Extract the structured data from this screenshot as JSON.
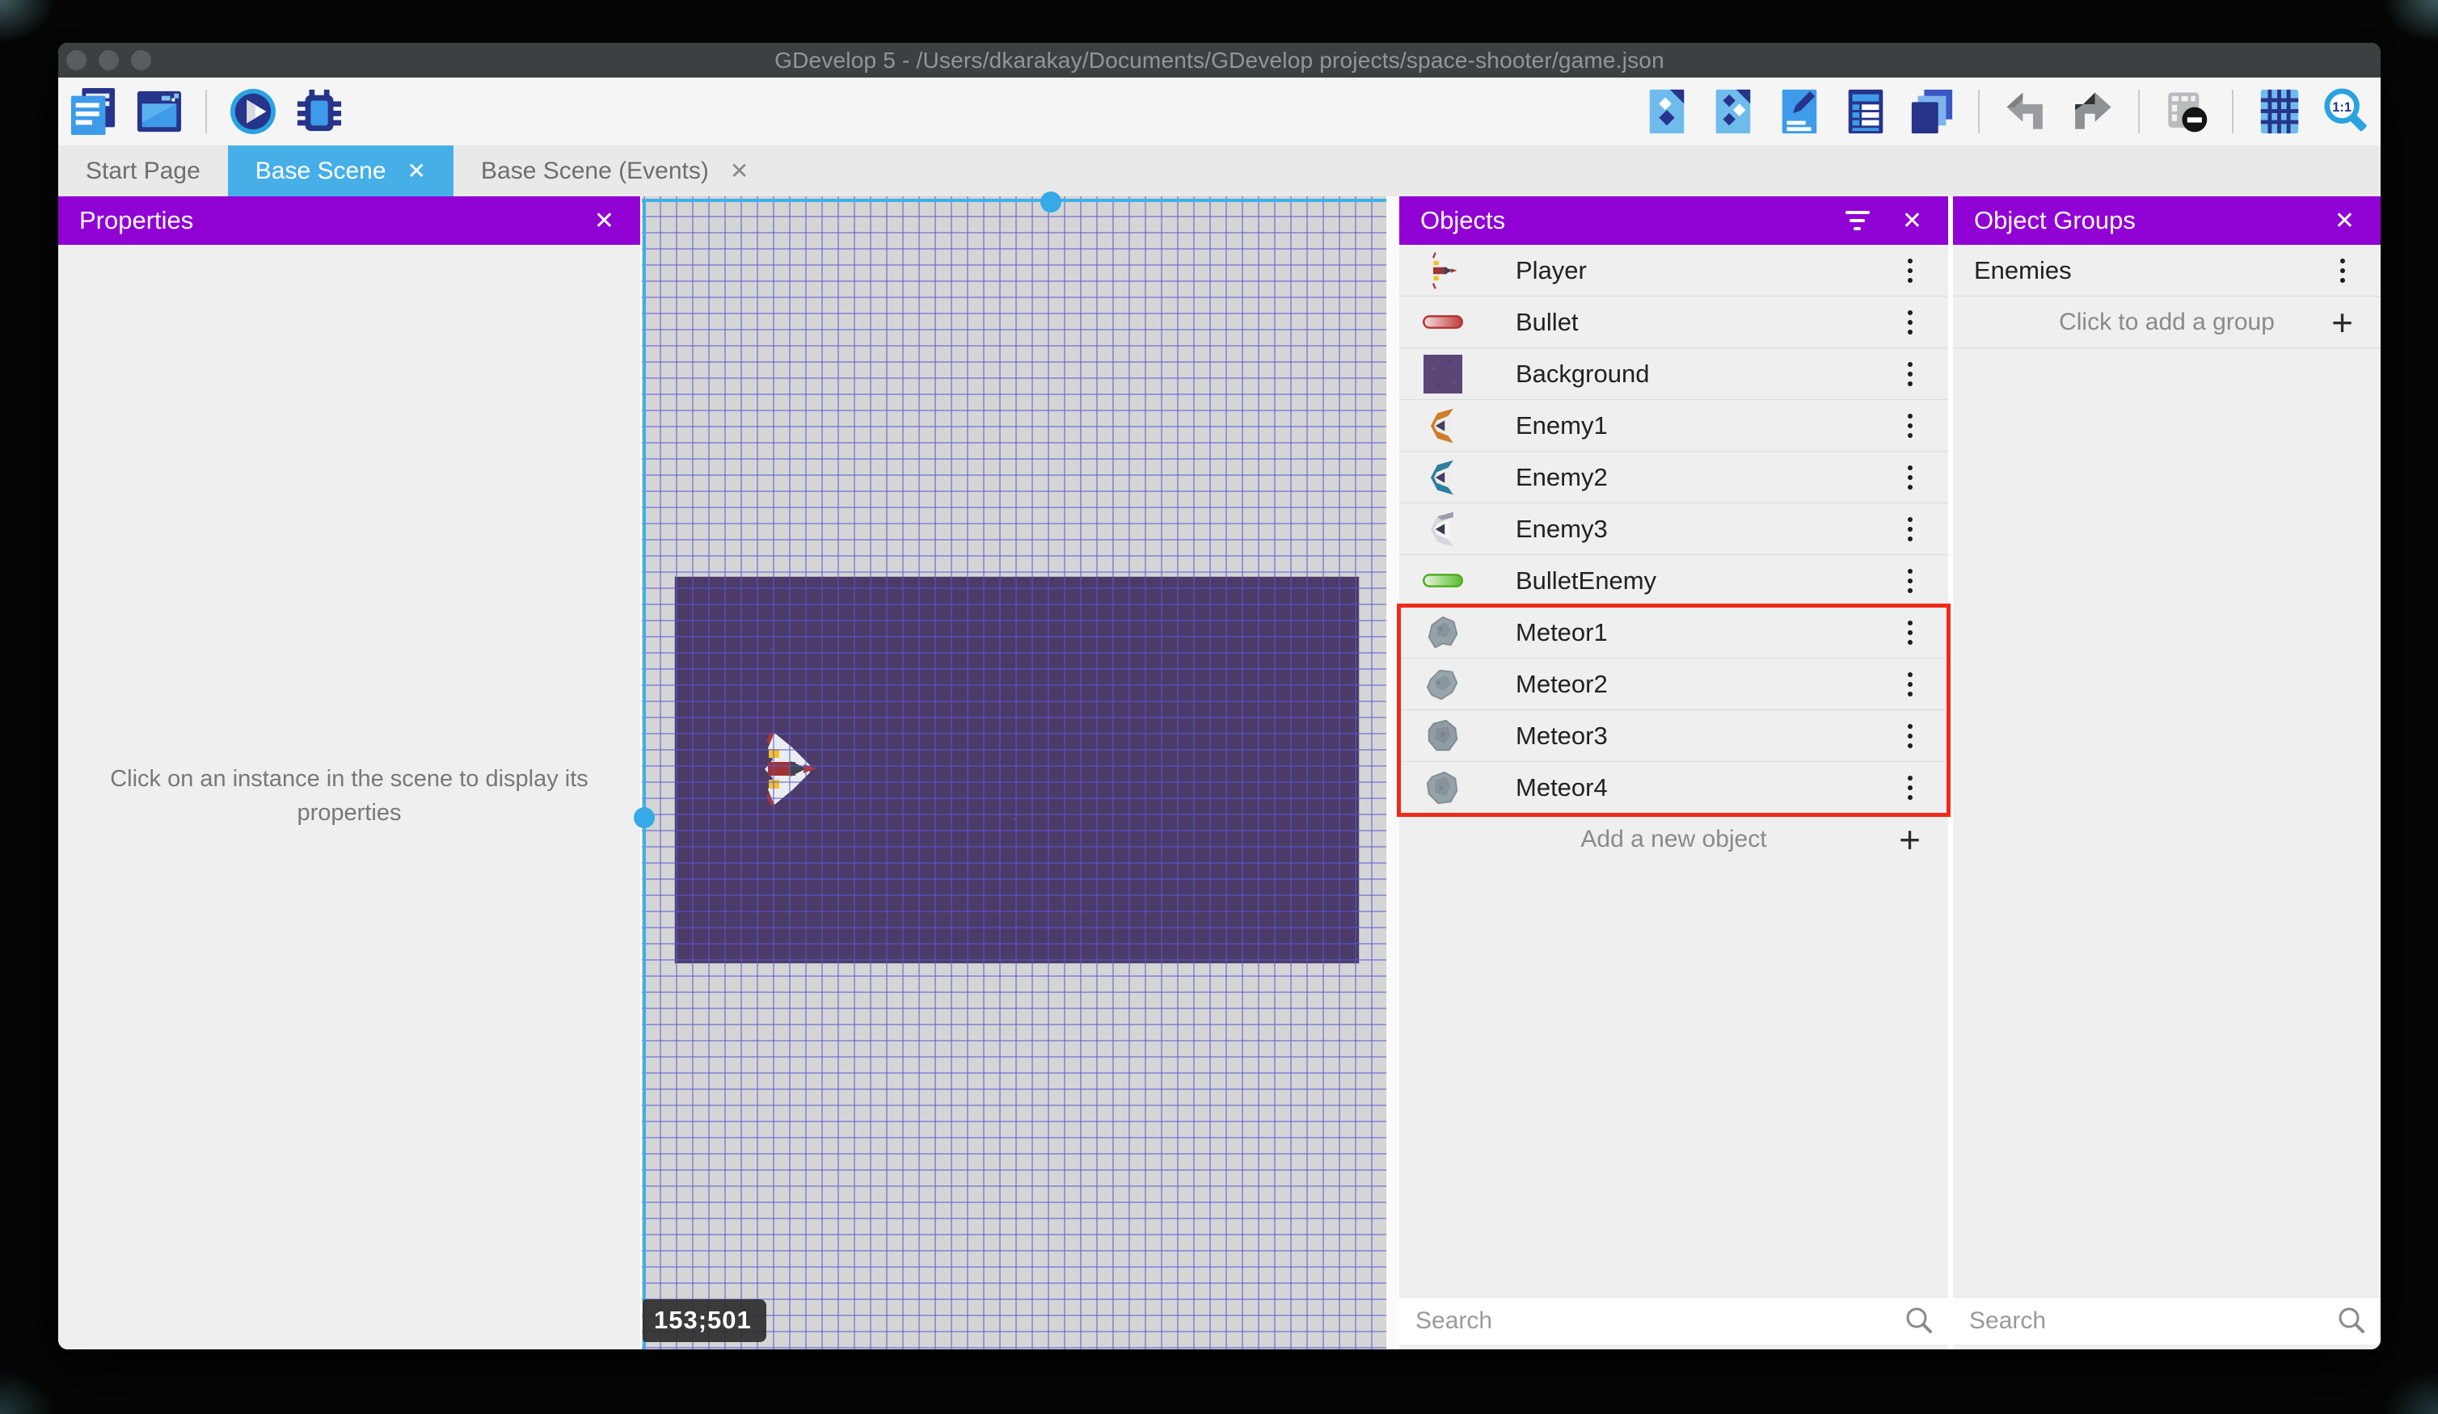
{
  "window": {
    "title": "GDevelop 5 - /Users/dkarakay/Documents/GDevelop projects/space-shooter/game.json",
    "close_glyph": "✕"
  },
  "toolbar": {
    "left_icons": [
      "project-manager-icon",
      "start-page-icon",
      "separator",
      "play-icon",
      "debug-icon"
    ],
    "right_icons": [
      "objects-panel-icon",
      "object-groups-icon",
      "properties-icon",
      "instances-list-icon",
      "layers-icon",
      "separator",
      "undo-icon",
      "redo-icon",
      "separator",
      "toggle-instances-mask-icon",
      "separator",
      "grid-icon",
      "zoom-1-1-icon"
    ]
  },
  "tabs": [
    {
      "label": "Start Page",
      "active": false,
      "closable": false
    },
    {
      "label": "Base Scene",
      "active": true,
      "closable": true
    },
    {
      "label": "Base Scene (Events)",
      "active": false,
      "closable": true
    }
  ],
  "properties_panel": {
    "title": "Properties",
    "hint": "Click on an instance in the scene to display its properties"
  },
  "scene": {
    "coordinate_badge": "153;501",
    "selected_object": "Background"
  },
  "objects_panel": {
    "title": "Objects",
    "items": [
      {
        "label": "Player",
        "icon": "player-ship-icon",
        "highlighted": false
      },
      {
        "label": "Bullet",
        "icon": "bullet-icon",
        "highlighted": false
      },
      {
        "label": "Background",
        "icon": "background-icon",
        "highlighted": false
      },
      {
        "label": "Enemy1",
        "icon": "enemy1-ship-icon",
        "highlighted": false
      },
      {
        "label": "Enemy2",
        "icon": "enemy2-ship-icon",
        "highlighted": false
      },
      {
        "label": "Enemy3",
        "icon": "enemy3-ship-icon",
        "highlighted": false
      },
      {
        "label": "BulletEnemy",
        "icon": "bullet-enemy-icon",
        "highlighted": false
      },
      {
        "label": "Meteor1",
        "icon": "meteor1-icon",
        "highlighted": true
      },
      {
        "label": "Meteor2",
        "icon": "meteor2-icon",
        "highlighted": true
      },
      {
        "label": "Meteor3",
        "icon": "meteor3-icon",
        "highlighted": true
      },
      {
        "label": "Meteor4",
        "icon": "meteor4-icon",
        "highlighted": true
      }
    ],
    "add_label": "Add a new object",
    "add_glyph": "+",
    "search_placeholder": "Search"
  },
  "object_groups_panel": {
    "title": "Object Groups",
    "groups": [
      {
        "label": "Enemies"
      }
    ],
    "add_label": "Click to add a group",
    "add_glyph": "+",
    "search_placeholder": "Search"
  },
  "colors": {
    "panel_header_purple": "#9002d4",
    "active_tab_blue": "#47afe8",
    "selection_cyan": "#3fb0e8",
    "highlight_red": "#ef2b18",
    "scene_background_purple": "#4c3b69",
    "grid_line_blue": "#5858d6",
    "toolbar_icon_navy": "#27348b",
    "toolbar_icon_blue": "#3d9be9"
  }
}
